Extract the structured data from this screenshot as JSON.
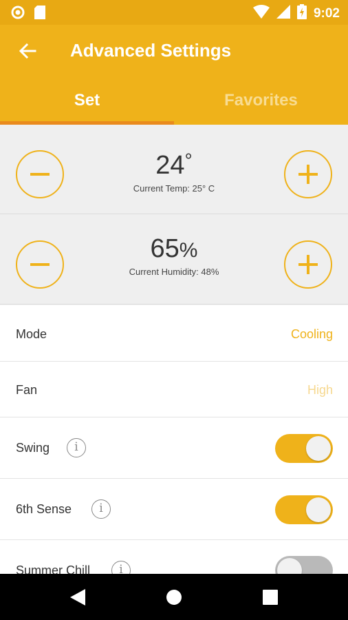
{
  "status_bar": {
    "time": "9:02",
    "icons": [
      "circle-icon",
      "sd-card-icon",
      "wifi-icon",
      "signal-icon",
      "battery-charging-icon"
    ]
  },
  "app_bar": {
    "title": "Advanced Settings",
    "back_icon": "arrow-left-icon",
    "tabs": [
      {
        "label": "Set",
        "active": true
      },
      {
        "label": "Favorites",
        "active": false
      }
    ]
  },
  "temperature": {
    "value": "24",
    "unit": "°",
    "current": "Current Temp: 25° C"
  },
  "humidity": {
    "value": "65",
    "unit": "%",
    "current": "Current Humidity: 48%"
  },
  "settings": [
    {
      "label": "Mode",
      "value": "Cooling"
    },
    {
      "label": "Fan",
      "value": "High"
    },
    {
      "label": "Swing",
      "toggle": true
    },
    {
      "label": "6th Sense",
      "toggle": true
    },
    {
      "label": "Summer Chill",
      "toggle": false
    }
  ],
  "colors": {
    "primary": "#efb21a",
    "status_bar": "#e8a913",
    "tab_indicator": "#e98a1d",
    "mode_value": "#efb21a",
    "fan_value": "#f6d88f"
  },
  "nav_bar": {
    "icons": [
      "back-triangle-icon",
      "home-circle-icon",
      "recents-square-icon"
    ]
  }
}
